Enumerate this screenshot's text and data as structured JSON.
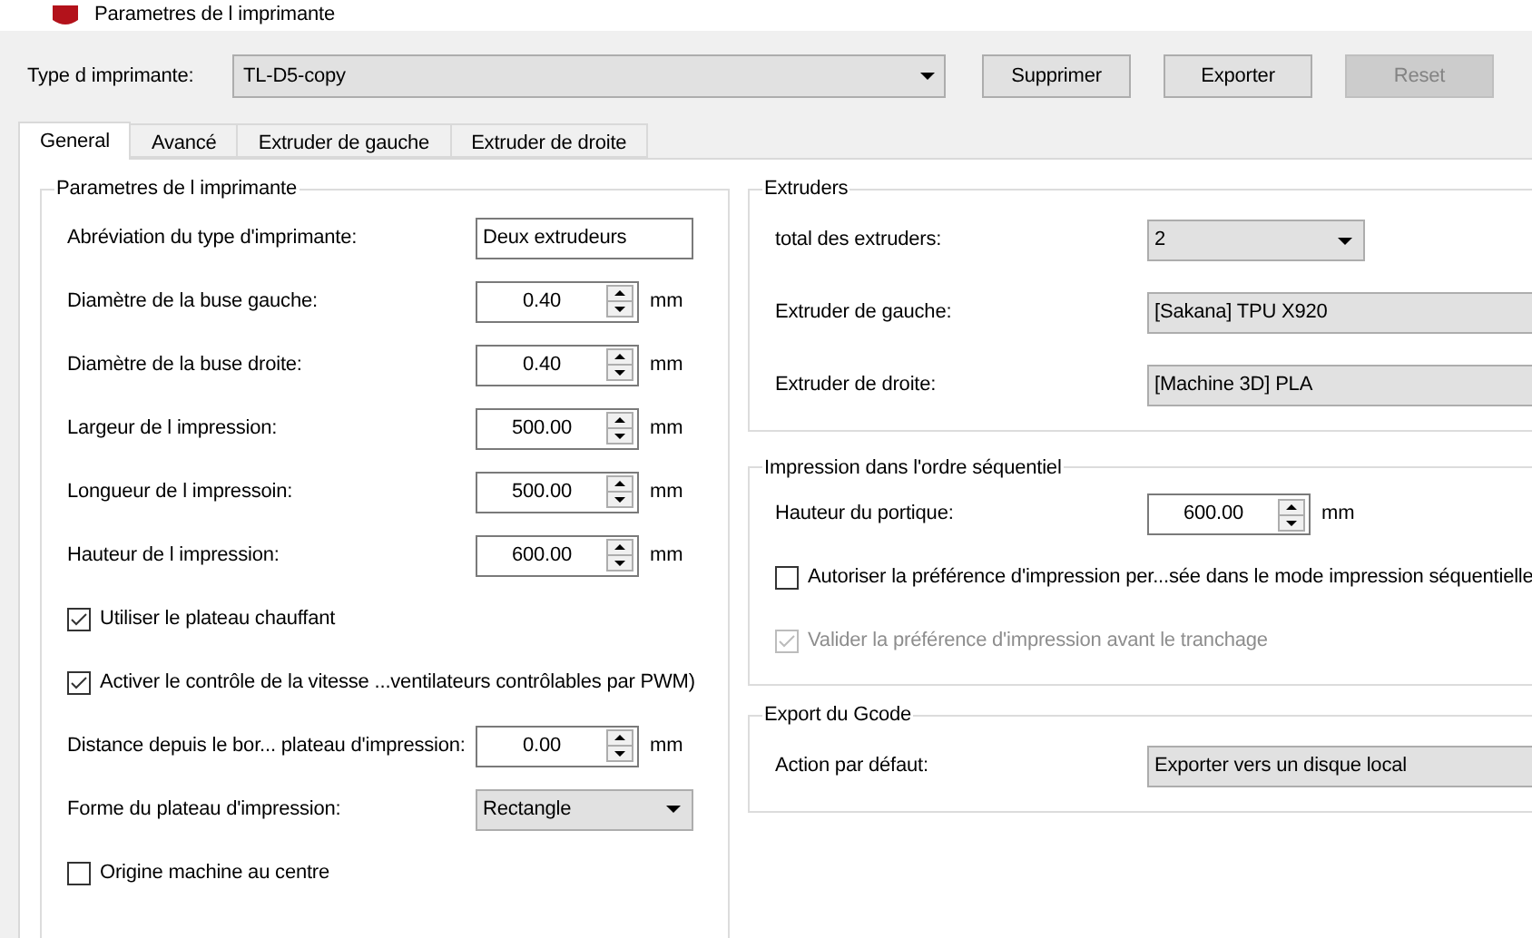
{
  "window": {
    "title": "Parametres de l imprimante"
  },
  "printer_type": {
    "label": "Type d imprimante:",
    "value": "TL-D5-copy"
  },
  "buttons": [
    {
      "label": "Supprimer",
      "disabled": false
    },
    {
      "label": "Exporter",
      "disabled": false
    },
    {
      "label": "Reset",
      "disabled": true
    }
  ],
  "tabs": [
    {
      "label": "General",
      "selected": true
    },
    {
      "label": "Avancé",
      "selected": false
    },
    {
      "label": "Extruder de gauche",
      "selected": false
    },
    {
      "label": "Extruder de droite",
      "selected": false
    }
  ],
  "left_group": {
    "title": "Parametres de l imprimante",
    "rows": [
      {
        "kind": "text",
        "label": "Abréviation du type d'imprimante:",
        "value": "Deux extrudeurs"
      },
      {
        "kind": "spin",
        "label": "Diamètre de la buse gauche:",
        "value": "0.40",
        "unit": "mm"
      },
      {
        "kind": "spin",
        "label": "Diamètre de la buse droite:",
        "value": "0.40",
        "unit": "mm"
      },
      {
        "kind": "spin",
        "label": "Largeur de l impression:",
        "value": "500.00",
        "unit": "mm"
      },
      {
        "kind": "spin",
        "label": "Longueur de l impressoin:",
        "value": "500.00",
        "unit": "mm"
      },
      {
        "kind": "spin",
        "label": "Hauteur de l impression:",
        "value": "600.00",
        "unit": "mm"
      },
      {
        "kind": "check",
        "label": "Utiliser le plateau chauffant",
        "checked": true,
        "disabled": false
      },
      {
        "kind": "check",
        "label": "Activer le contrôle de la vitesse ...ventilateurs contrôlables par PWM)",
        "checked": true,
        "disabled": false
      },
      {
        "kind": "spin",
        "label": "Distance depuis le bor... plateau d'impression:",
        "value": "0.00",
        "unit": "mm"
      },
      {
        "kind": "combo",
        "label": "Forme du plateau d'impression:",
        "value": "Rectangle"
      },
      {
        "kind": "check",
        "label": "Origine machine au centre",
        "checked": false,
        "disabled": false
      }
    ]
  },
  "right_groups": [
    {
      "title": "Extruders",
      "rows": [
        {
          "kind": "combo",
          "label": "total des extruders:",
          "value": "2"
        },
        {
          "kind": "wide_combo",
          "label": "Extruder de gauche:",
          "value": "[Sakana] TPU X920"
        },
        {
          "kind": "wide_combo",
          "label": "Extruder de droite:",
          "value": "[Machine 3D] PLA"
        }
      ]
    },
    {
      "title": "Impression dans l'ordre séquentiel",
      "rows": [
        {
          "kind": "spin",
          "label": "Hauteur du portique:",
          "value": "600.00",
          "unit": "mm"
        },
        {
          "kind": "check",
          "label": "Autoriser la préférence d'impression per...sée dans le mode impression séquentielle",
          "checked": false,
          "disabled": false
        },
        {
          "kind": "check",
          "label": "Valider la préférence d'impression avant le tranchage",
          "checked": true,
          "disabled": true
        }
      ]
    },
    {
      "title": "Export du Gcode",
      "rows": [
        {
          "kind": "wide_combo",
          "label": "Action par défaut:",
          "value": "Exporter vers un disque local"
        }
      ]
    }
  ]
}
